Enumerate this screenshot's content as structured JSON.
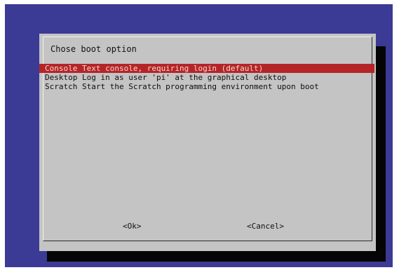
{
  "dialog": {
    "title": "Chose boot option",
    "items": [
      {
        "label": "Console Text console, requiring login (default)",
        "selected": true
      },
      {
        "label": "Desktop Log in as user 'pi' at the graphical desktop",
        "selected": false
      },
      {
        "label": "Scratch Start the Scratch programming environment upon boot",
        "selected": false
      }
    ],
    "ok_label": "<Ok>",
    "cancel_label": "<Cancel>"
  },
  "colors": {
    "background": "#3b3a95",
    "dialog": "#c4c4c4",
    "shadow": "#050505",
    "selection": "#b52527"
  }
}
